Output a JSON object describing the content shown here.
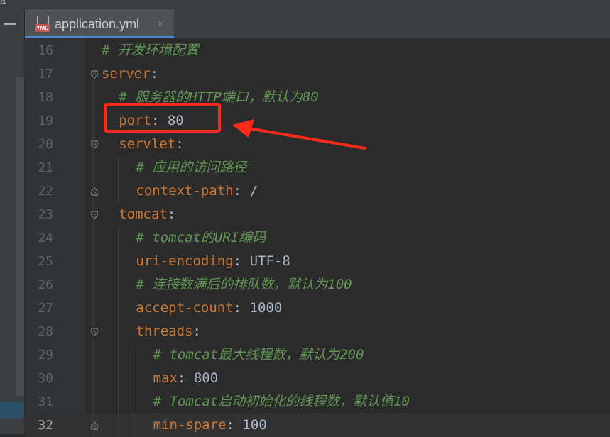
{
  "window": {
    "partial_title": "a"
  },
  "tab": {
    "icon_badge": "YML",
    "title": "application.yml",
    "close_glyph": "×"
  },
  "editor": {
    "current_line": "32",
    "lines": [
      {
        "num": "16",
        "indent": 0,
        "kind": "comment",
        "text": "# 开发环境配置"
      },
      {
        "num": "17",
        "indent": 0,
        "kind": "key",
        "key": "server",
        "sep": ":",
        "value": ""
      },
      {
        "num": "18",
        "indent": 1,
        "kind": "comment",
        "text": "# 服务器的HTTP端口，默认为80"
      },
      {
        "num": "19",
        "indent": 1,
        "kind": "key",
        "key": "port",
        "sep": ": ",
        "value": "80"
      },
      {
        "num": "20",
        "indent": 1,
        "kind": "key",
        "key": "servlet",
        "sep": ":",
        "value": ""
      },
      {
        "num": "21",
        "indent": 2,
        "kind": "comment",
        "text": "# 应用的访问路径"
      },
      {
        "num": "22",
        "indent": 2,
        "kind": "key",
        "key": "context-path",
        "sep": ": ",
        "value": "/"
      },
      {
        "num": "23",
        "indent": 1,
        "kind": "key",
        "key": "tomcat",
        "sep": ":",
        "value": ""
      },
      {
        "num": "24",
        "indent": 2,
        "kind": "comment",
        "text": "# tomcat的URI编码"
      },
      {
        "num": "25",
        "indent": 2,
        "kind": "key",
        "key": "uri-encoding",
        "sep": ": ",
        "value": "UTF-8"
      },
      {
        "num": "26",
        "indent": 2,
        "kind": "comment",
        "text": "# 连接数满后的排队数，默认为100"
      },
      {
        "num": "27",
        "indent": 2,
        "kind": "key",
        "key": "accept-count",
        "sep": ": ",
        "value": "1000"
      },
      {
        "num": "28",
        "indent": 2,
        "kind": "key",
        "key": "threads",
        "sep": ":",
        "value": ""
      },
      {
        "num": "29",
        "indent": 3,
        "kind": "comment",
        "text": "# tomcat最大线程数，默认为200"
      },
      {
        "num": "30",
        "indent": 3,
        "kind": "key",
        "key": "max",
        "sep": ": ",
        "value": "800"
      },
      {
        "num": "31",
        "indent": 3,
        "kind": "comment",
        "text": "# Tomcat启动初始化的线程数，默认值10"
      },
      {
        "num": "32",
        "indent": 3,
        "kind": "key",
        "key": "min-spare",
        "sep": ": ",
        "value": "100"
      }
    ]
  },
  "annotation": {
    "color": "#ff2a1a",
    "target_line": "19"
  },
  "colors": {
    "background": "#2b2b2b",
    "key": "#cc7832",
    "value": "#a9b7c6",
    "comment": "#629755",
    "line_number": "#606366"
  }
}
